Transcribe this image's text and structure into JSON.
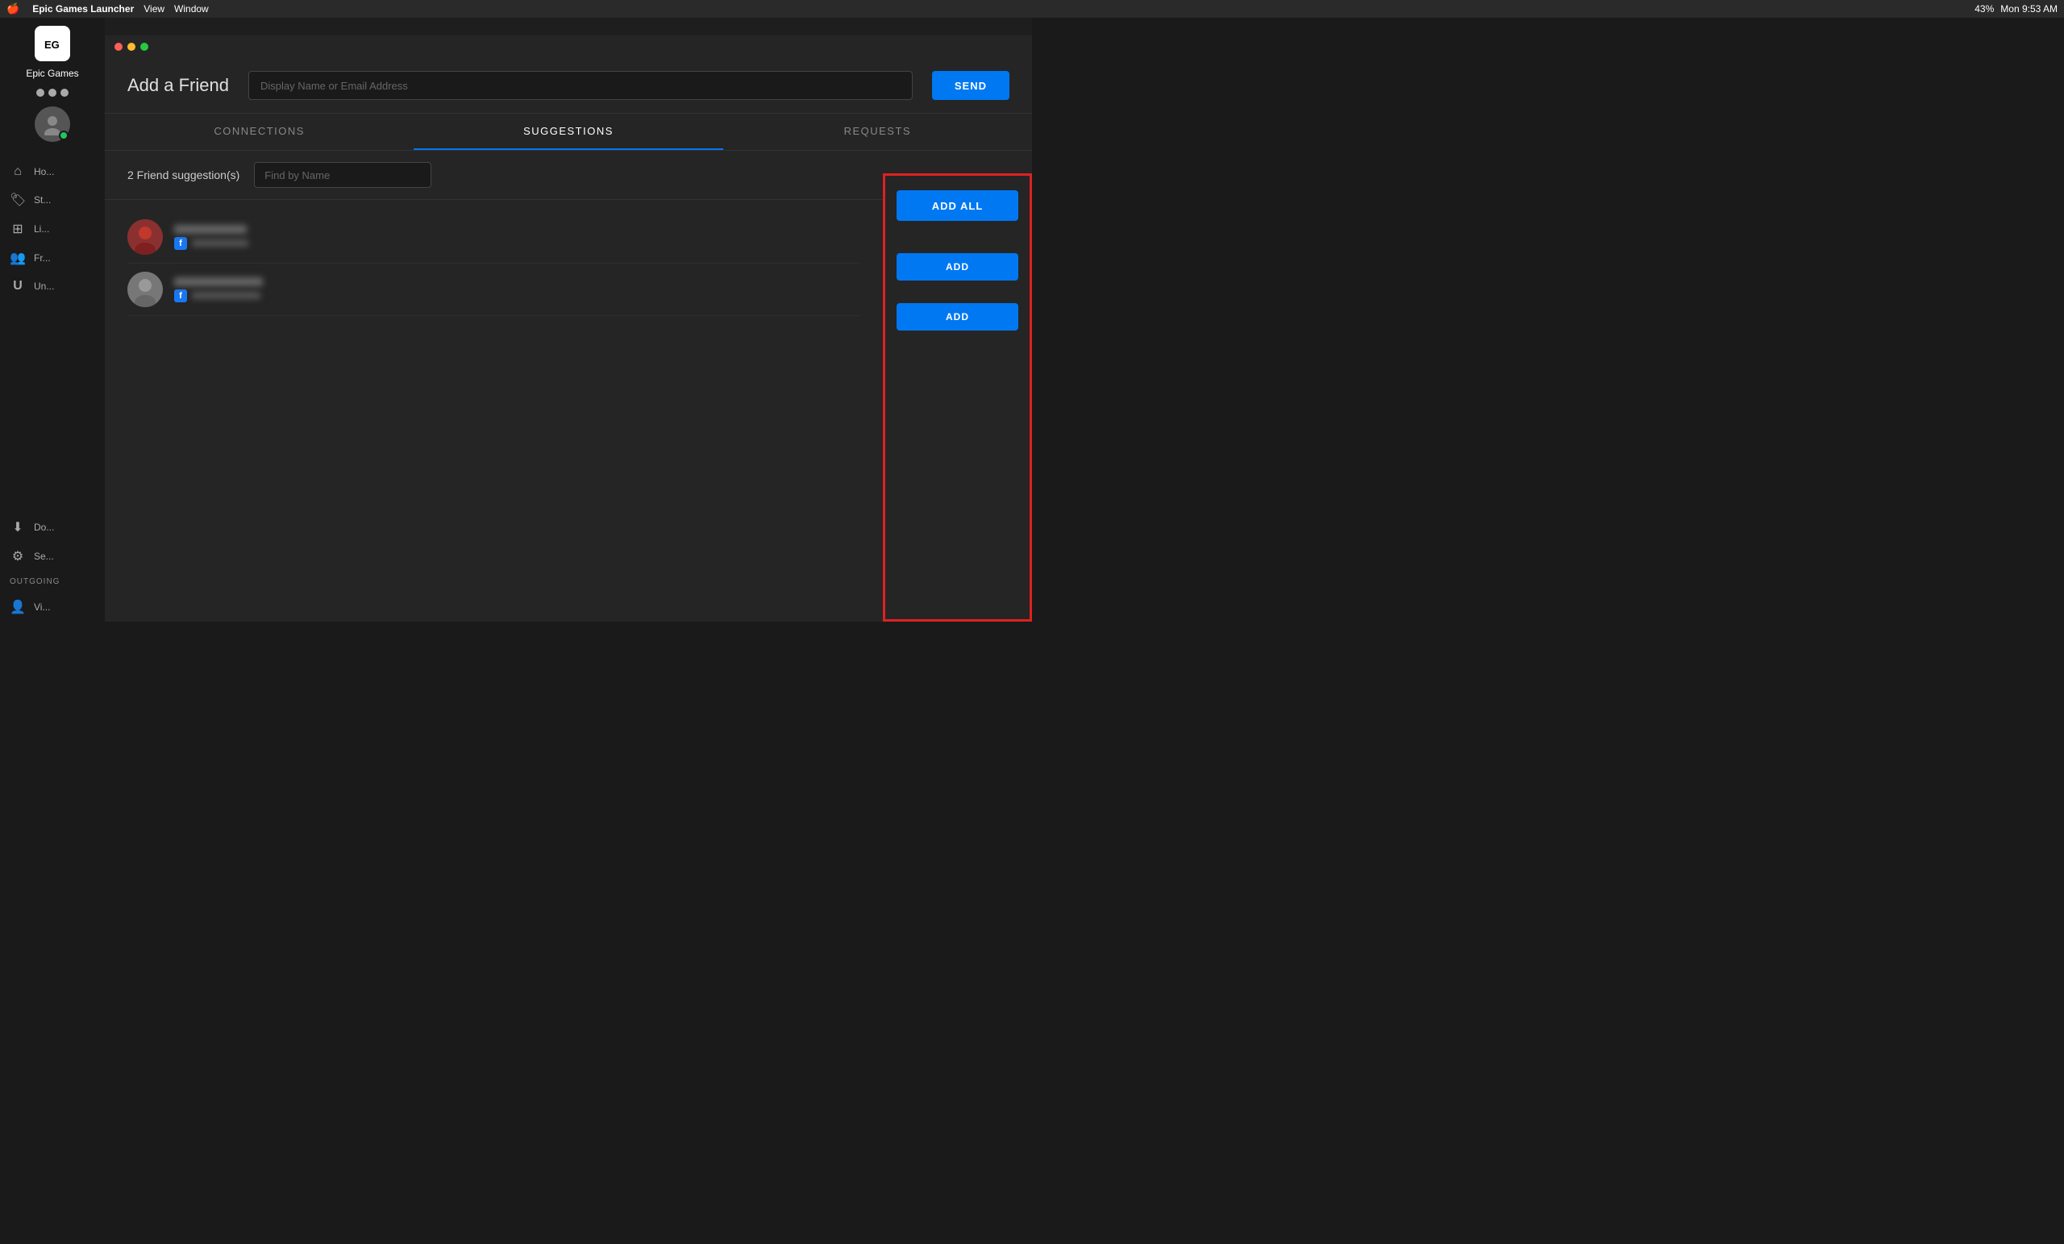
{
  "menubar": {
    "apple": "🍎",
    "app_name": "Epic Games Launcher",
    "menu_items": [
      "View",
      "Window"
    ],
    "time": "Mon 9:53 AM",
    "battery": "43%"
  },
  "sidebar": {
    "brand": "Epic Games",
    "nav_items": [
      {
        "id": "home",
        "icon": "⌂",
        "label": "Ho..."
      },
      {
        "id": "store",
        "icon": "🏷",
        "label": "St..."
      },
      {
        "id": "library",
        "icon": "⊞",
        "label": "Li..."
      },
      {
        "id": "friends",
        "icon": "👥",
        "label": "Fr..."
      },
      {
        "id": "unreal",
        "icon": "U",
        "label": "Un..."
      },
      {
        "id": "downloads",
        "icon": "⬇",
        "label": "Do..."
      },
      {
        "id": "settings",
        "icon": "⚙",
        "label": "Se..."
      },
      {
        "id": "profile",
        "icon": "👤",
        "label": "Vi..."
      }
    ],
    "outgoing_label": "OUTGOING"
  },
  "panel": {
    "title": "Add a Friend",
    "search_placeholder": "Display Name or Email Address",
    "send_button": "SEND",
    "tabs": [
      {
        "id": "connections",
        "label": "CONNECTIONS"
      },
      {
        "id": "suggestions",
        "label": "SUGGESTIONS",
        "active": true
      },
      {
        "id": "requests",
        "label": "REQUESTS"
      }
    ],
    "filter": {
      "count_label": "2 Friend suggestion(s)",
      "find_placeholder": "Find by Name"
    },
    "suggestions": [
      {
        "id": 1,
        "name_blurred": "Blurred Name",
        "via_text_blurred": "blurred text",
        "avatar_type": "avatar-1"
      },
      {
        "id": 2,
        "name_blurred": "Blurred Name Two",
        "via_text_blurred": "blurred via text",
        "avatar_type": "avatar-2"
      }
    ],
    "action_buttons": {
      "add_all": "ADD ALL",
      "add": "ADD"
    }
  }
}
